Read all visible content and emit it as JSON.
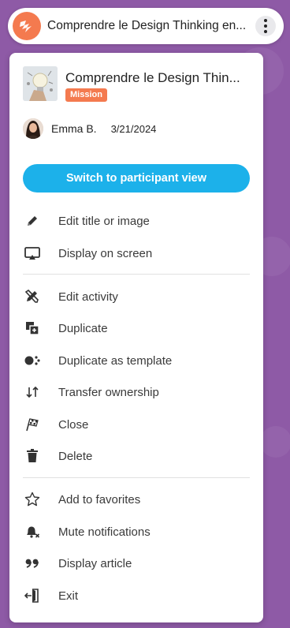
{
  "topbar": {
    "title": "Comprendre le Design Thinking en..."
  },
  "activity": {
    "title": "Comprendre le Design Thin...",
    "badge": "Mission",
    "author": "Emma B.",
    "date": "3/21/2024"
  },
  "switch_button": "Switch to participant view",
  "menu": {
    "edit_title": "Edit title or image",
    "display_screen": "Display on screen",
    "edit_activity": "Edit activity",
    "duplicate": "Duplicate",
    "duplicate_template": "Duplicate as template",
    "transfer": "Transfer ownership",
    "close": "Close",
    "delete": "Delete",
    "favorites": "Add to favorites",
    "mute": "Mute notifications",
    "article": "Display article",
    "exit": "Exit"
  },
  "colors": {
    "background": "#8e5aa6",
    "brand_orange": "#f47a4f",
    "primary_blue": "#1cb1ea"
  }
}
